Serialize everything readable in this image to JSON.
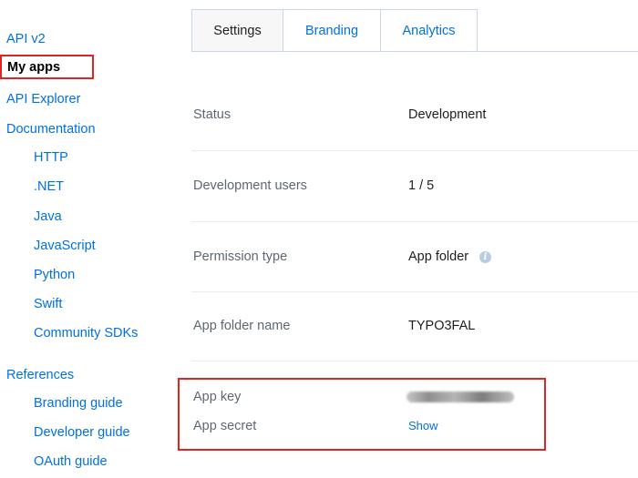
{
  "sidebar": {
    "api_v2": "API v2",
    "my_apps": "My apps",
    "api_explorer": "API Explorer",
    "documentation": "Documentation",
    "doc_items": [
      "HTTP",
      ".NET",
      "Java",
      "JavaScript",
      "Python",
      "Swift",
      "Community SDKs"
    ],
    "references": "References",
    "ref_items": [
      "Branding guide",
      "Developer guide",
      "OAuth guide"
    ]
  },
  "tabs": [
    {
      "label": "Settings",
      "active": true
    },
    {
      "label": "Branding",
      "active": false
    },
    {
      "label": "Analytics",
      "active": false
    }
  ],
  "settings": {
    "status": {
      "label": "Status",
      "value": "Development"
    },
    "dev_users": {
      "label": "Development users",
      "value": "1 / 5"
    },
    "permission": {
      "label": "Permission type",
      "value": "App folder"
    },
    "folder": {
      "label": "App folder name",
      "value": "TYPO3FAL"
    },
    "app_key": {
      "label": "App key"
    },
    "app_secret": {
      "label": "App secret",
      "action": "Show"
    }
  },
  "colors": {
    "link": "#0070e0",
    "highlight": "#e02424",
    "label": "#5d6772"
  }
}
